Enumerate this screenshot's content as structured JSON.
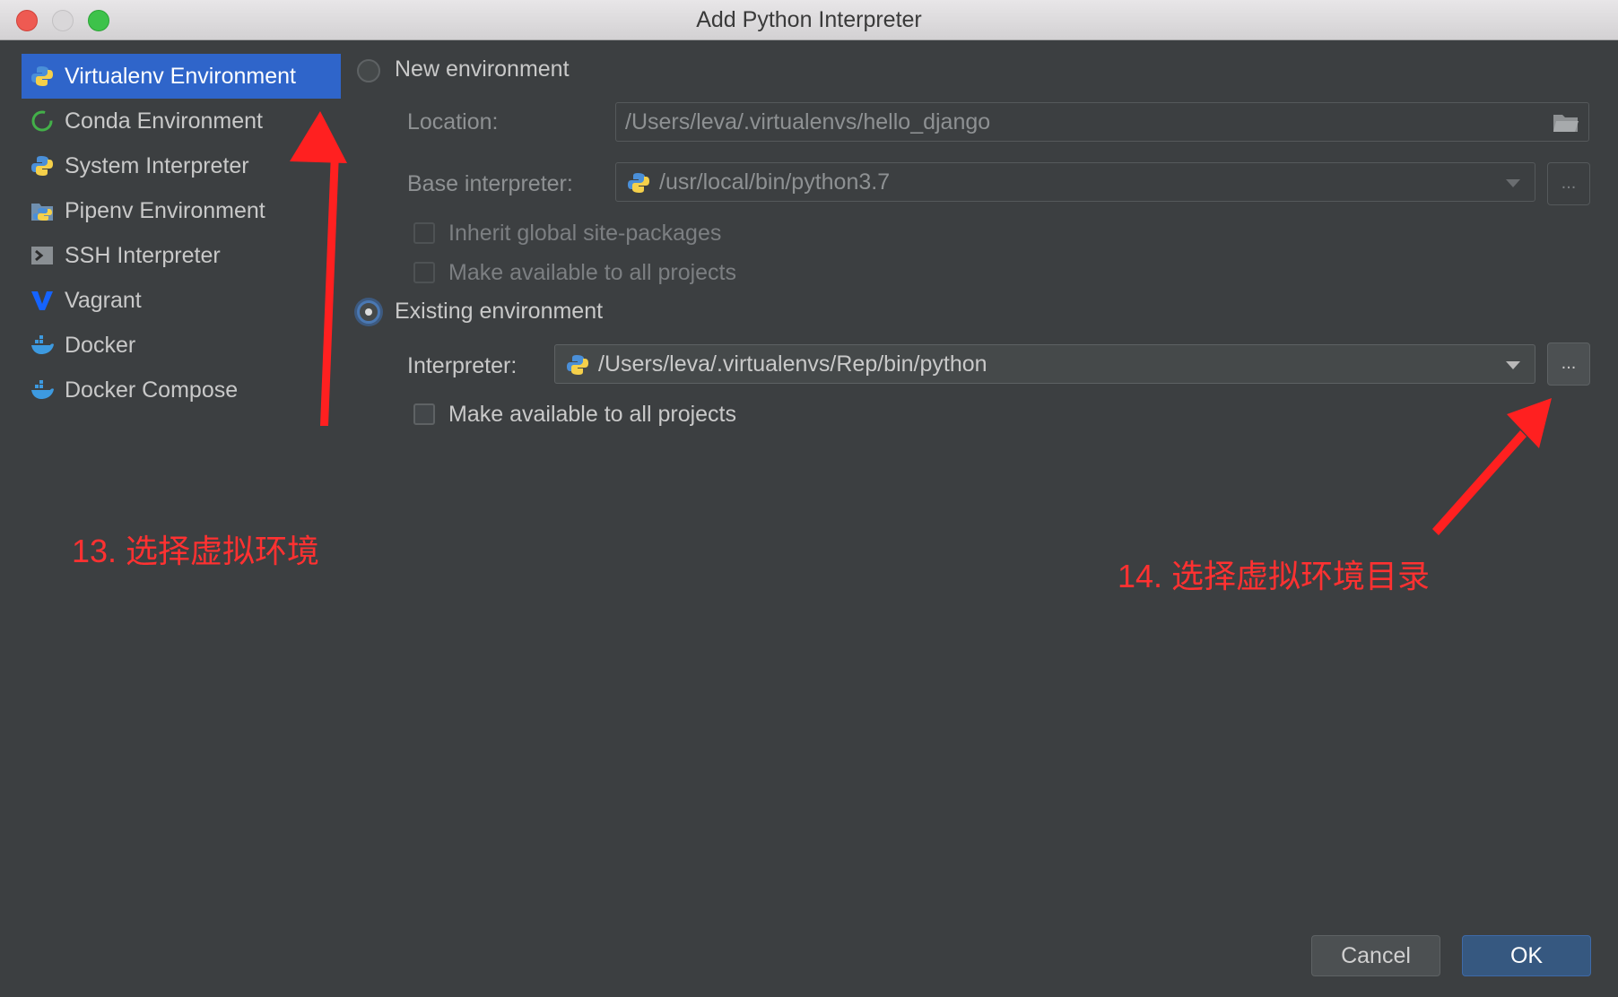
{
  "window": {
    "title": "Add Python Interpreter"
  },
  "sidebar": {
    "items": [
      {
        "label": "Virtualenv Environment",
        "icon": "python-icon",
        "selected": true
      },
      {
        "label": "Conda Environment",
        "icon": "conda-icon"
      },
      {
        "label": "System Interpreter",
        "icon": "python-icon"
      },
      {
        "label": "Pipenv Environment",
        "icon": "pipenv-icon"
      },
      {
        "label": "SSH Interpreter",
        "icon": "ssh-terminal-icon"
      },
      {
        "label": "Vagrant",
        "icon": "vagrant-icon"
      },
      {
        "label": "Docker",
        "icon": "docker-icon"
      },
      {
        "label": "Docker Compose",
        "icon": "docker-compose-icon"
      }
    ]
  },
  "new_env": {
    "radio_label": "New environment",
    "location_label": "Location:",
    "location_value": "/Users/leva/.virtualenvs/hello_django",
    "base_label": "Base interpreter:",
    "base_value": "/usr/local/bin/python3.7",
    "inherit_label": "Inherit global site-packages",
    "make_available_label": "Make available to all projects",
    "browse": "..."
  },
  "existing_env": {
    "radio_label": "Existing environment",
    "selected": true,
    "interpreter_label": "Interpreter:",
    "interpreter_value": "/Users/leva/.virtualenvs/Rep/bin/python",
    "make_available_label": "Make available to all projects",
    "browse": "..."
  },
  "annotations": {
    "step13": "13. 选择虚拟环境",
    "step14": "14. 选择虚拟环境目录",
    "color": "#ff3131"
  },
  "footer": {
    "cancel_label": "Cancel",
    "ok_label": "OK"
  },
  "colors": {
    "background": "#3c3f41",
    "selection": "#2f65ca",
    "ok_button": "#365880"
  }
}
